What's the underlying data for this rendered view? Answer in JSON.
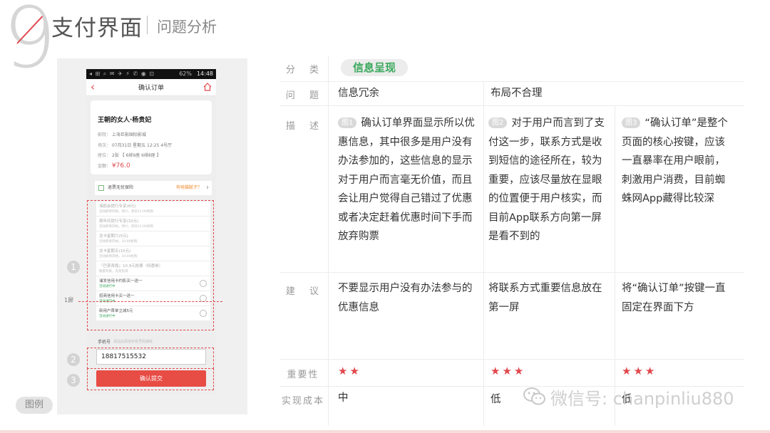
{
  "header": {
    "page_number": "9",
    "title": "支付界面",
    "subtitle": "问题分析"
  },
  "phone": {
    "status_time": "14:48",
    "status_battery": "62%",
    "nav_title": "确认订单",
    "ticket": {
      "movie": "王朝的女人·杨贵妃",
      "cinema_label": "影院：",
      "cinema": "上海巨影国际影城",
      "showtime_label": "场次：",
      "showtime": "07月31日  星期五  12:25  4号厅",
      "seat_label": "座位：",
      "seat": "2张  【 6排9座 6排8座 】",
      "amount_label": "金额：",
      "amount": "¥76.0"
    },
    "insurance": {
      "label": "退票无忧保险",
      "ask": "有啥猫腻子？"
    },
    "promos": [
      {
        "name": "海鸥会提行专享(8元)",
        "status": "活动即将开始，周六、周日11:00抢购",
        "active": false
      },
      {
        "name": "周年庆提行专享(10元)",
        "status": "活动即将开始，周六、周日11:00抢购",
        "active": false
      },
      {
        "name": "龙卡星期六(5元)",
        "status": "活动即将开始，10:00抢购",
        "active": false
      },
      {
        "name": "龙卡星期五(15元)",
        "status": "活动即将开始，10:00抢购",
        "active": false
      },
      {
        "name": "『巴掌青霞』10.9元抢票（特惠券）",
        "status": "数量有限，先到先得",
        "active": false
      },
      {
        "name": "浦发信用卡约影买一送一",
        "status": "活动进行中",
        "active": true
      },
      {
        "name": "招商信用卡买一送一",
        "status": "活动进行中",
        "active": true
      },
      {
        "name": "新用户首单立减5元",
        "status": "活动进行中",
        "active": true
      }
    ],
    "phone_label": "手机号",
    "phone_hint": "请在此添加手机号码接收",
    "phone_number": "18817515532",
    "submit_label": "确认提交",
    "screen_marker": "1屏",
    "markers": [
      "1",
      "2",
      "3"
    ]
  },
  "legend_tag": "图例",
  "table": {
    "rows": {
      "category": "分 类",
      "problem": "问 题",
      "description": "描 述",
      "suggestion": "建 议",
      "importance": "重要性",
      "cost": "实现成本"
    },
    "category_tag": "信息呈现",
    "columns": [
      {
        "problem": "信息冗余",
        "fig": "图1",
        "description": "确认订单界面显示所以优惠信息，其中很多是用户没有办法参加的，这些信息的显示对于用户而言毫无价值，而且会让用户觉得自己错过了优惠或者决定赶着优惠时间下手而放弃购票",
        "suggestion": "不要显示用户没有办法参与的优惠信息",
        "importance": "★★",
        "cost": "中"
      },
      {
        "problem": "布局不合理",
        "fig": "图2",
        "description": "对于用户而言到了支付这一步，联系方式是收到短信的途径所在，较为重要，应该尽量放在显眼的位置便于用户核实，而目前App联系方向第一屏是看不到的",
        "suggestion": "将联系方式重要信息放在第一屏",
        "importance": "★★★",
        "cost": "低"
      },
      {
        "problem": "",
        "fig": "图3",
        "description": "“确认订单”是整个页面的核心按键，应该一直暴率在用户眼前，刺激用户消费，目前蜘蛛网App藏得比较深",
        "suggestion": "将“确认订单”按键一直固定在界面下方",
        "importance": "★★★",
        "cost": "低"
      }
    ]
  },
  "watermark": "微信号: chanpinliu880",
  "colors": {
    "accent_red": "#e0484d",
    "accent_green": "#39a85c"
  }
}
